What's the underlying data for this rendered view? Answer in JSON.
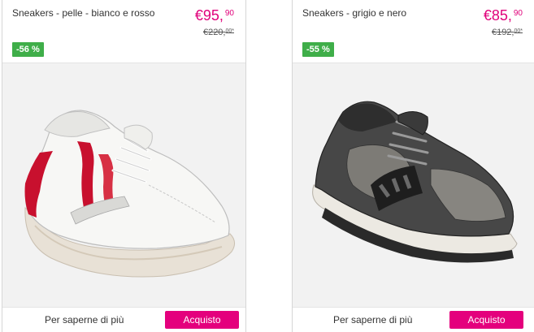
{
  "products": [
    {
      "name": "Sneakers - pelle - bianco e rosso",
      "price_main": "€95,",
      "price_cents": "90",
      "old_price_main": "€220,",
      "old_price_cents": "00*",
      "discount": "-56 %",
      "more_label": "Per saperne di più",
      "buy_label": "Acquisto",
      "image_icon": "white-red-sneaker-photo",
      "accent_color": "#c8102e"
    },
    {
      "name": "Sneakers - grigio e nero",
      "price_main": "€85,",
      "price_cents": "90",
      "old_price_main": "€192,",
      "old_price_cents": "00*",
      "discount": "-55 %",
      "more_label": "Per saperne di più",
      "buy_label": "Acquisto",
      "image_icon": "grey-black-sneaker-photo",
      "accent_color": "#3a3a3a"
    }
  ],
  "colors": {
    "price": "#e0007a",
    "discount_badge": "#3fae49",
    "buy_button": "#e4007d"
  }
}
